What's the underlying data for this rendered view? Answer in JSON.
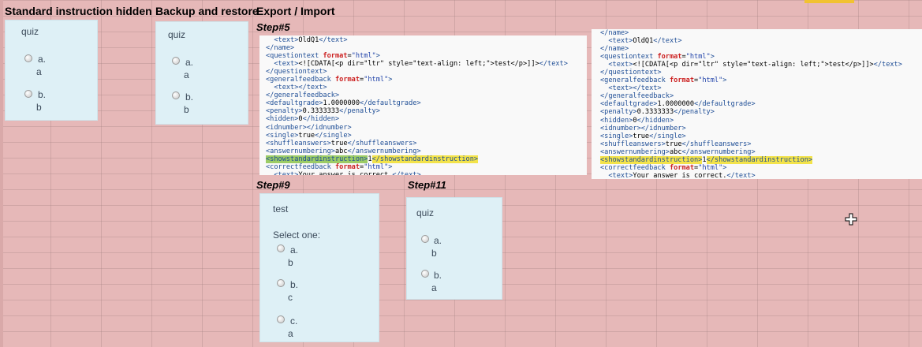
{
  "headings": {
    "standard": "Standard instruction hidden",
    "backup": "Backup and restore",
    "export": "Export / Import"
  },
  "steps": {
    "step5": "Step#5",
    "step9": "Step#9",
    "step11": "Step#11"
  },
  "cards": {
    "standard": {
      "title": "quiz",
      "options": [
        {
          "letter": "a.",
          "answer": "a"
        },
        {
          "letter": "b.",
          "answer": "b"
        }
      ]
    },
    "backup": {
      "title": "quiz",
      "options": [
        {
          "letter": "a.",
          "answer": "a"
        },
        {
          "letter": "b.",
          "answer": "b"
        }
      ]
    },
    "step9": {
      "title": "test",
      "prompt": "Select one:",
      "options": [
        {
          "letter": "a.",
          "answer": "b"
        },
        {
          "letter": "b.",
          "answer": "c"
        },
        {
          "letter": "c.",
          "answer": "a"
        }
      ]
    },
    "step11": {
      "title": "quiz",
      "options": [
        {
          "letter": "a.",
          "answer": "b"
        },
        {
          "letter": "b.",
          "answer": "a"
        }
      ]
    }
  },
  "xml_left": [
    [
      [
        "t",
        "  <text>"
      ],
      [
        "x",
        "OldQ1"
      ],
      [
        "t",
        "</text>"
      ]
    ],
    [
      [
        "t",
        "</name>"
      ]
    ],
    [
      [
        "t",
        "<questiontext "
      ],
      [
        "a",
        "format"
      ],
      [
        "x",
        "="
      ],
      [
        "s",
        "\"html\""
      ],
      [
        "t",
        ">"
      ]
    ],
    [
      [
        "t",
        "  <text>"
      ],
      [
        "x",
        "<![CDATA[<p dir=\"ltr\" style=\"text-align: left;\">test</p>]]>"
      ],
      [
        "t",
        "</text>"
      ]
    ],
    [
      [
        "t",
        "</questiontext>"
      ]
    ],
    [
      [
        "t",
        "<generalfeedback "
      ],
      [
        "a",
        "format"
      ],
      [
        "x",
        "="
      ],
      [
        "s",
        "\"html\""
      ],
      [
        "t",
        ">"
      ]
    ],
    [
      [
        "t",
        "  <text></text>"
      ]
    ],
    [
      [
        "t",
        "</generalfeedback>"
      ]
    ],
    [
      [
        "t",
        "<defaultgrade>"
      ],
      [
        "x",
        "1.0000000"
      ],
      [
        "t",
        "</defaultgrade>"
      ]
    ],
    [
      [
        "t",
        "<penalty>"
      ],
      [
        "x",
        "0.3333333"
      ],
      [
        "t",
        "</penalty>"
      ]
    ],
    [
      [
        "t",
        "<hidden>"
      ],
      [
        "x",
        "0"
      ],
      [
        "t",
        "</hidden>"
      ]
    ],
    [
      [
        "t",
        "<idnumber></idnumber>"
      ]
    ],
    [
      [
        "t",
        "<single>"
      ],
      [
        "x",
        "true"
      ],
      [
        "t",
        "</single>"
      ]
    ],
    [
      [
        "t",
        "<shuffleanswers>"
      ],
      [
        "x",
        "true"
      ],
      [
        "t",
        "</shuffleanswers>"
      ]
    ],
    [
      [
        "t",
        "<answernumbering>"
      ],
      [
        "x",
        "abc"
      ],
      [
        "t",
        "</answernumbering>"
      ]
    ],
    [
      [
        "g",
        "<showstandardinstruction>"
      ],
      [
        "x",
        "1"
      ],
      [
        "y",
        "</showstandardinstruction>"
      ]
    ],
    [
      [
        "t",
        "<correctfeedback "
      ],
      [
        "a",
        "format"
      ],
      [
        "x",
        "="
      ],
      [
        "s",
        "\"html\""
      ],
      [
        "t",
        ">"
      ]
    ],
    [
      [
        "t",
        "  <text>"
      ],
      [
        "x",
        "Your answer is correct."
      ],
      [
        "t",
        "</text>"
      ]
    ]
  ],
  "xml_right": [
    [
      [
        "t",
        "</name>"
      ]
    ],
    [
      [
        "t",
        "  <text>"
      ],
      [
        "x",
        "OldQ1"
      ],
      [
        "t",
        "</text>"
      ]
    ],
    [
      [
        "t",
        "</name>"
      ]
    ],
    [
      [
        "t",
        "<questiontext "
      ],
      [
        "a",
        "format"
      ],
      [
        "x",
        "="
      ],
      [
        "s",
        "\"html\""
      ],
      [
        "t",
        ">"
      ]
    ],
    [
      [
        "t",
        "  <text>"
      ],
      [
        "x",
        "<![CDATA[<p dir=\"ltr\" style=\"text-align: left;\">test</p>]]>"
      ],
      [
        "t",
        "</text>"
      ]
    ],
    [
      [
        "t",
        "</questiontext>"
      ]
    ],
    [
      [
        "t",
        "<generalfeedback "
      ],
      [
        "a",
        "format"
      ],
      [
        "x",
        "="
      ],
      [
        "s",
        "\"html\""
      ],
      [
        "t",
        ">"
      ]
    ],
    [
      [
        "t",
        "  <text></text>"
      ]
    ],
    [
      [
        "t",
        "</generalfeedback>"
      ]
    ],
    [
      [
        "t",
        "<defaultgrade>"
      ],
      [
        "x",
        "1.0000000"
      ],
      [
        "t",
        "</defaultgrade>"
      ]
    ],
    [
      [
        "t",
        "<penalty>"
      ],
      [
        "x",
        "0.3333333"
      ],
      [
        "t",
        "</penalty>"
      ]
    ],
    [
      [
        "t",
        "<hidden>"
      ],
      [
        "x",
        "0"
      ],
      [
        "t",
        "</hidden>"
      ]
    ],
    [
      [
        "t",
        "<idnumber></idnumber>"
      ]
    ],
    [
      [
        "t",
        "<single>"
      ],
      [
        "x",
        "true"
      ],
      [
        "t",
        "</single>"
      ]
    ],
    [
      [
        "t",
        "<shuffleanswers>"
      ],
      [
        "x",
        "true"
      ],
      [
        "t",
        "</shuffleanswers>"
      ]
    ],
    [
      [
        "t",
        "<answernumbering>"
      ],
      [
        "x",
        "abc"
      ],
      [
        "t",
        "</answernumbering>"
      ]
    ],
    [
      [
        "y",
        "<showstandardinstruction>"
      ],
      [
        "x",
        "1"
      ],
      [
        "y",
        "</showstandardinstruction>"
      ]
    ],
    [
      [
        "t",
        "<correctfeedback "
      ],
      [
        "a",
        "format"
      ],
      [
        "x",
        "="
      ],
      [
        "s",
        "\"html\""
      ],
      [
        "t",
        ">"
      ]
    ],
    [
      [
        "t",
        "  <text>"
      ],
      [
        "x",
        "Your answer is correct."
      ],
      [
        "t",
        "</text>"
      ]
    ]
  ],
  "colors": {
    "background": "#e6b8b8",
    "card": "#def0f6",
    "tag": "#1f4e96",
    "highlight_green": "#9ccc66",
    "highlight_yellow": "#f3e34a"
  },
  "icons": {
    "cursor": "crosshair-cursor-icon"
  }
}
